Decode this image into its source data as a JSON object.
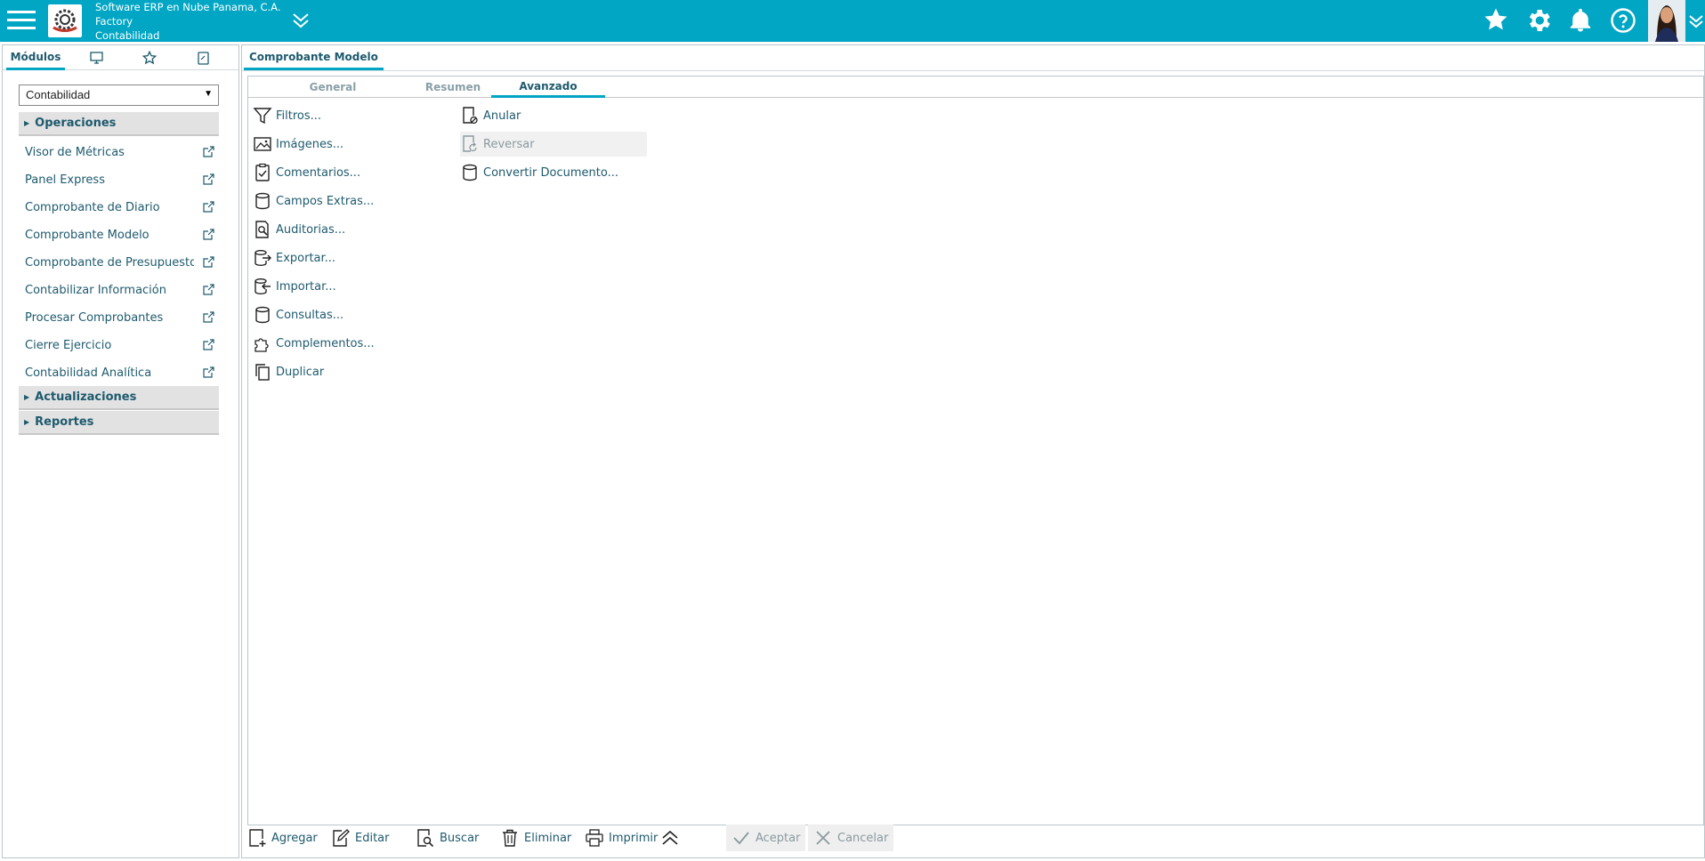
{
  "header": {
    "company": "Software ERP en Nube Panama, C.A.",
    "line2": "Factory",
    "line3": "Contabilidad",
    "colors": {
      "bar": "#00a6c4",
      "text": "#1e5a6e"
    }
  },
  "left": {
    "tabs": {
      "modulos": "Módulos"
    },
    "module_select": "Contabilidad",
    "sections": {
      "operaciones": "Operaciones",
      "actualizaciones": "Actualizaciones",
      "reportes": "Reportes"
    },
    "items": [
      "Visor de Métricas",
      "Panel Express",
      "Comprobante de Diario",
      "Comprobante Modelo",
      "Comprobante de Presupuesto",
      "Contabilizar Información",
      "Procesar Comprobantes",
      "Cierre Ejercicio",
      "Contabilidad Analítica"
    ]
  },
  "main": {
    "tab_title": "Comprobante Modelo",
    "subtabs": {
      "general": "General",
      "resumen": "Resumen",
      "avanzado": "Avanzado"
    },
    "col1": [
      "Filtros...",
      "Imágenes...",
      "Comentarios...",
      "Campos Extras...",
      "Auditorias...",
      "Exportar...",
      "Importar...",
      "Consultas...",
      "Complementos...",
      "Duplicar"
    ],
    "col2": [
      "Anular",
      "Reversar",
      "Convertir Documento..."
    ]
  },
  "toolbar": {
    "agregar": "Agregar",
    "editar": "Editar",
    "buscar": "Buscar",
    "eliminar": "Eliminar",
    "imprimir": "Imprimir",
    "aceptar": "Aceptar",
    "cancelar": "Cancelar"
  }
}
